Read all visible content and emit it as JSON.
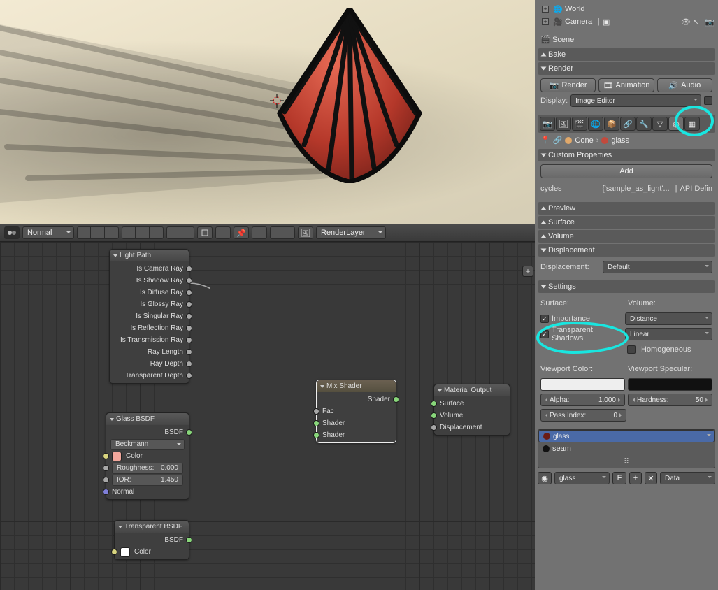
{
  "outliner": {
    "items": [
      {
        "label": "World",
        "icon_color": "#d8b25a"
      },
      {
        "label": "Camera",
        "icon_color": "#f0c060"
      }
    ]
  },
  "scene_row": {
    "label": "Scene"
  },
  "panels": {
    "bake": "Bake",
    "render": "Render",
    "preview": "Preview",
    "surface": "Surface",
    "volume": "Volume",
    "displacement": "Displacement",
    "settings": "Settings",
    "custom_props": "Custom Properties"
  },
  "render": {
    "render_btn": "Render",
    "animation_btn": "Animation",
    "audio_btn": "Audio",
    "display_label": "Display:",
    "display_value": "Image Editor"
  },
  "custom_props": {
    "add": "Add",
    "key": "cycles",
    "value": "{'sample_as_light'...",
    "api": "API Defin"
  },
  "displacement": {
    "label": "Displacement:",
    "value": "Default"
  },
  "settings": {
    "surface_label": "Surface:",
    "volume_label": "Volume:",
    "importance": "Importance",
    "transparent_shadows": "Transparent Shadows",
    "distance": "Distance",
    "linear": "Linear",
    "homogeneous": "Homogeneous",
    "vcolor": "Viewport Color:",
    "vspec": "Viewport Specular:",
    "alpha_lbl": "Alpha:",
    "alpha_val": "1.000",
    "hardness_lbl": "Hardness:",
    "hardness_val": "50",
    "pass_lbl": "Pass Index:",
    "pass_val": "0"
  },
  "materials": {
    "glass": "glass",
    "seam": "seam",
    "data": "Data"
  },
  "breadcrumb": {
    "pin": "📌",
    "cone": "Cone",
    "glass": "glass"
  },
  "node_header": {
    "shading": "Normal",
    "renderlayer": "RenderLayer"
  },
  "nodes": {
    "light_path": {
      "title": "Light Path",
      "outs": [
        "Is Camera Ray",
        "Is Shadow Ray",
        "Is Diffuse Ray",
        "Is Glossy Ray",
        "Is Singular Ray",
        "Is Reflection Ray",
        "Is Transmission Ray",
        "Ray Length",
        "Ray Depth",
        "Transparent Depth"
      ]
    },
    "glass": {
      "title": "Glass BSDF",
      "bsdf": "BSDF",
      "distribution": "Beckmann",
      "color_lbl": "Color",
      "rough_lbl": "Roughness:",
      "rough_val": "0.000",
      "ior_lbl": "IOR:",
      "ior_val": "1.450",
      "normal": "Normal"
    },
    "transparent": {
      "title": "Transparent BSDF",
      "bsdf": "BSDF",
      "color_lbl": "Color"
    },
    "mix": {
      "title": "Mix Shader",
      "out": "Shader",
      "fac": "Fac",
      "sh1": "Shader",
      "sh2": "Shader"
    },
    "output": {
      "title": "Material Output",
      "surface": "Surface",
      "volume": "Volume",
      "disp": "Displacement"
    }
  }
}
